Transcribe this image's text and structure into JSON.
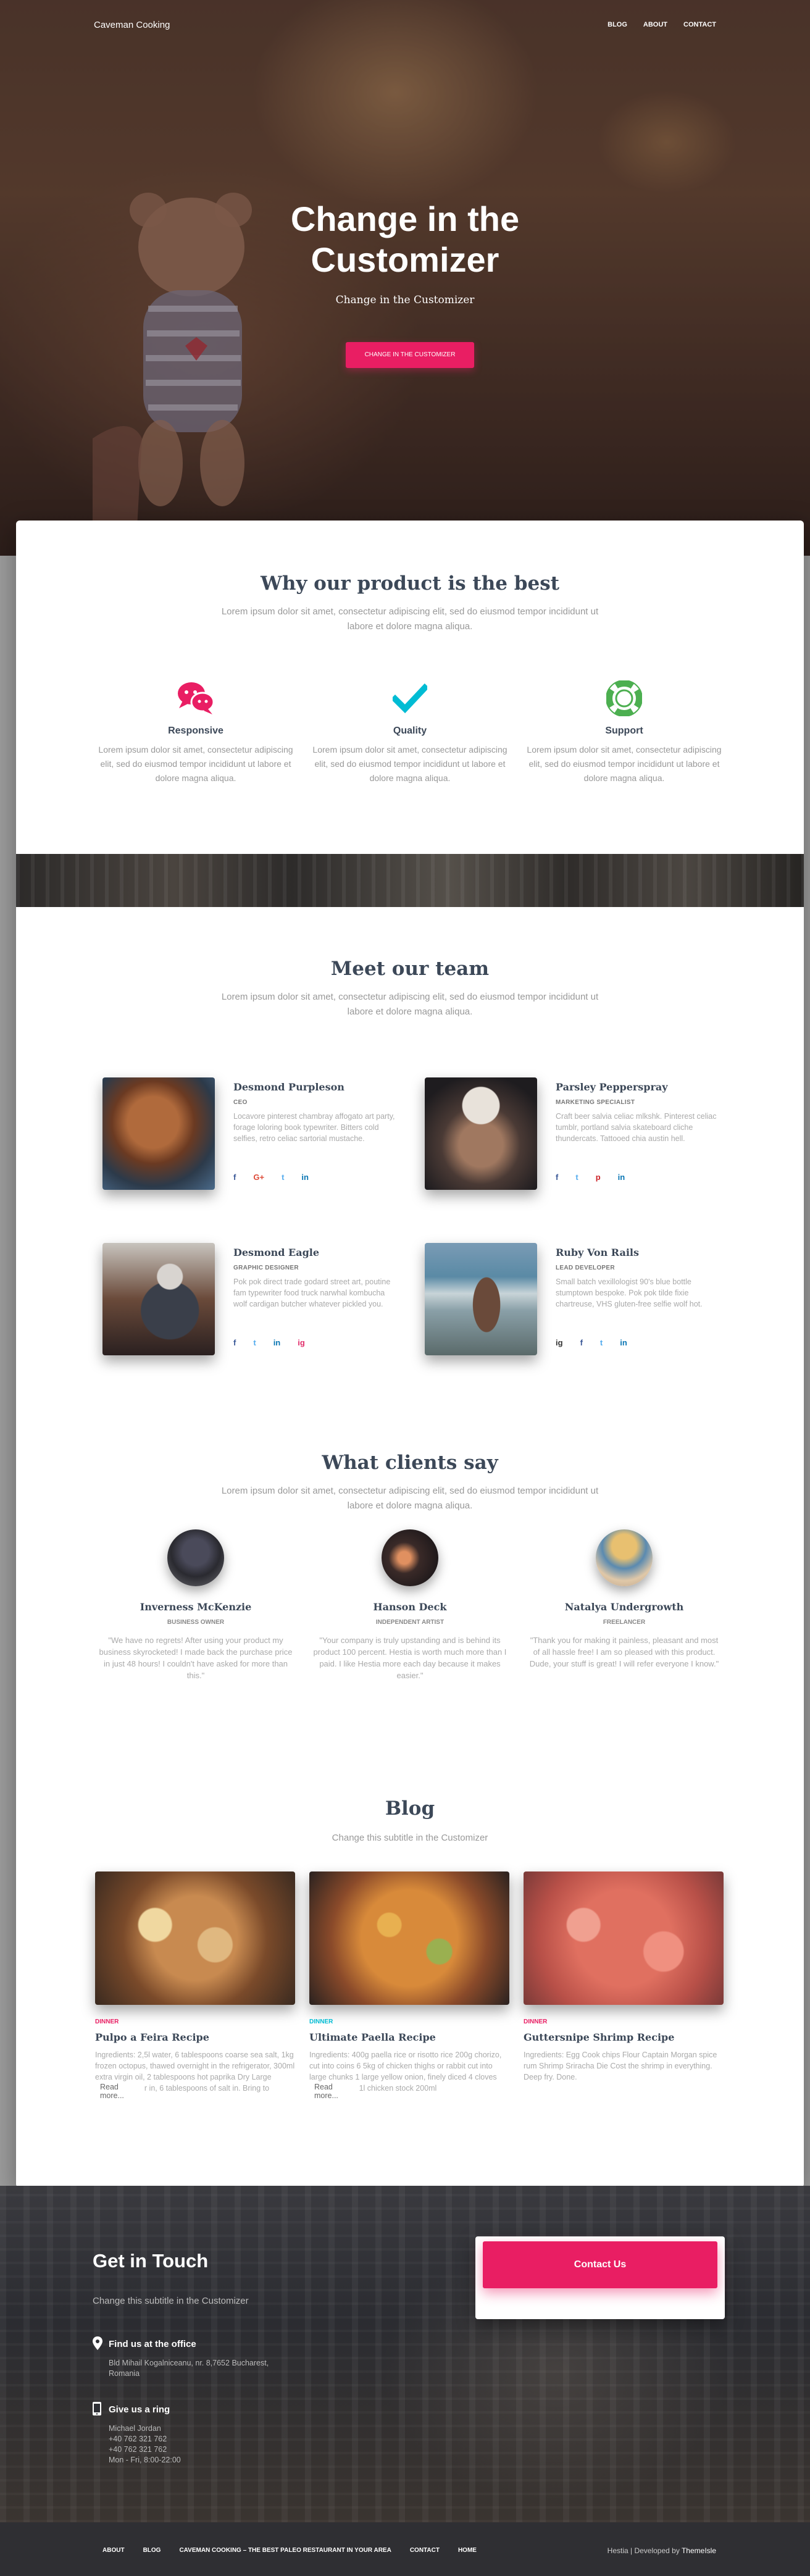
{
  "nav": {
    "brand": "Caveman Cooking",
    "links": [
      "BLOG",
      "ABOUT",
      "CONTACT"
    ]
  },
  "hero": {
    "title": "Change in the Customizer",
    "subtitle": "Change in the Customizer",
    "button": "CHANGE IN THE CUSTOMIZER"
  },
  "features": {
    "title": "Why our product is the best",
    "description": "Lorem ipsum dolor sit amet, consectetur adipiscing elit, sed do eiusmod tempor incididunt ut labore et dolore magna aliqua.",
    "items": [
      {
        "title": "Responsive",
        "text": "Lorem ipsum dolor sit amet, consectetur adipiscing elit, sed do eiusmod tempor incididunt ut labore et dolore magna aliqua.",
        "icon": "chat-bubbles-icon",
        "color": "#e91e63"
      },
      {
        "title": "Quality",
        "text": "Lorem ipsum dolor sit amet, consectetur adipiscing elit, sed do eiusmod tempor incididunt ut labore et dolore magna aliqua.",
        "icon": "checkmark-icon",
        "color": "#00bcd4"
      },
      {
        "title": "Support",
        "text": "Lorem ipsum dolor sit amet, consectetur adipiscing elit, sed do eiusmod tempor incididunt ut labore et dolore magna aliqua.",
        "icon": "life-ring-icon",
        "color": "#4caf50"
      }
    ]
  },
  "team": {
    "title": "Meet our team",
    "description": "Lorem ipsum dolor sit amet, consectetur adipiscing elit, sed do eiusmod tempor incididunt ut labore et dolore magna aliqua.",
    "members": [
      {
        "name": "Desmond Purpleson",
        "role": "CEO",
        "bio": "Locavore pinterest chambray affogato art party, forage loloring book typewriter. Bitters cold selfies, retro celiac sartorial mustache.",
        "socials": [
          "f",
          "G+",
          "t",
          "in"
        ]
      },
      {
        "name": "Parsley Pepperspray",
        "role": "MARKETING SPECIALIST",
        "bio": "Craft beer salvia celiac mlkshk. Pinterest celiac tumblr, portland salvia skateboard cliche thundercats. Tattooed chia austin hell.",
        "socials": [
          "f",
          "t",
          "p",
          "in"
        ]
      },
      {
        "name": "Desmond Eagle",
        "role": "GRAPHIC DESIGNER",
        "bio": "Pok pok direct trade godard street art, poutine fam typewriter food truck narwhal kombucha wolf cardigan butcher whatever pickled you.",
        "socials": [
          "f",
          "t",
          "in",
          "ig"
        ]
      },
      {
        "name": "Ruby Von Rails",
        "role": "LEAD DEVELOPER",
        "bio": "Small batch vexillologist 90's blue bottle stumptown bespoke. Pok pok tilde fixie chartreuse, VHS gluten-free selfie wolf hot.",
        "socials": [
          "ig",
          "f",
          "t",
          "in"
        ]
      }
    ]
  },
  "testimonials": {
    "title": "What clients say",
    "description": "Lorem ipsum dolor sit amet, consectetur adipiscing elit, sed do eiusmod tempor incididunt ut labore et dolore magna aliqua.",
    "items": [
      {
        "name": "Inverness McKenzie",
        "role": "BUSINESS OWNER",
        "quote": "\"We have no regrets! After using your product my business skyrocketed! I made back the purchase price in just 48 hours! I couldn't have asked for more than this.\""
      },
      {
        "name": "Hanson Deck",
        "role": "INDEPENDENT ARTIST",
        "quote": "\"Your company is truly upstanding and is behind its product 100 percent. Hestia is worth much more than I paid. I like Hestia more each day because it makes easier.\""
      },
      {
        "name": "Natalya Undergrowth",
        "role": "FREELANCER",
        "quote": "\"Thank you for making it painless, pleasant and most of all hassle free! I am so pleased with this product. Dude, your stuff is great! I will refer everyone I know.\""
      }
    ]
  },
  "blog": {
    "title": "Blog",
    "subtitle": "Change this subtitle in the Customizer",
    "read_more": "Read more...",
    "posts": [
      {
        "category": "DINNER",
        "cat_color": "#e91e63",
        "title": "Pulpo a Feira Recipe",
        "excerpt": "Ingredients: 2,5l water, 6 tablespoons coarse sea salt, 1kg frozen octopus, thawed overnight in the refrigerator, 300ml extra virgin oil, 2 tablespoons hot paprika Dry Large stockpot, water in, 6 tablespoons of salt in. Bring to"
      },
      {
        "category": "DINNER",
        "cat_color": "#00bcd4",
        "title": "Ultimate Paella Recipe",
        "excerpt": "Ingredients: 400g paella rice or risotto rice 200g chorizo, cut into coins 6 5kg of chicken thighs or rabbit cut into large chunks 1 large yellow onion, finely diced 4 cloves garlic, minced 1l chicken stock 200ml"
      },
      {
        "category": "DINNER",
        "cat_color": "#e91e63",
        "title": "Guttersnipe Shrimp Recipe",
        "excerpt": "Ingredients: Egg Cook chips Flour Captain Morgan spice rum Shrimp Sriracha Die Cost the shrimp in everything. Deep fry. Done."
      }
    ]
  },
  "contact": {
    "title": "Get in Touch",
    "subtitle": "Change this subtitle in the Customizer",
    "office_title": "Find us at the office",
    "office_lines": [
      "Bld Mihail Kogalniceanu, nr. 8,7652 Bucharest,",
      "Romania"
    ],
    "phone_title": "Give us a ring",
    "phone_lines": [
      "Michael Jordan",
      "+40 762 321 762",
      "+40 762 321 762",
      "Mon - Fri, 8:00-22:00"
    ],
    "button": "Contact Us"
  },
  "footer": {
    "links": [
      "ABOUT",
      "BLOG",
      "CAVEMAN COOKING – THE BEST PALEO RESTAURANT IN YOUR AREA",
      "CONTACT",
      "HOME"
    ],
    "credit": "Hestia | Developed by ",
    "credit_link": "ThemeIsle"
  }
}
